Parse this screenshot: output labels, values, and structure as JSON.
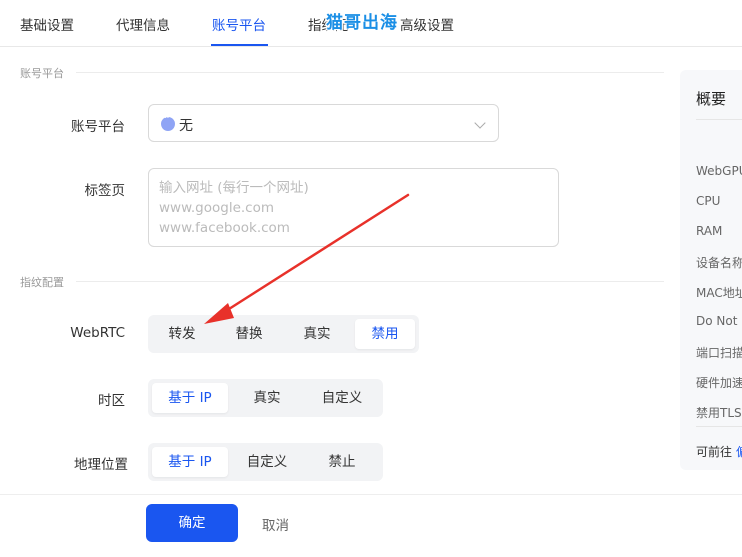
{
  "tabs": [
    {
      "label": "基础设置"
    },
    {
      "label": "代理信息"
    },
    {
      "label": "账号平台"
    },
    {
      "label": "指纹配置"
    },
    {
      "label": "高级设置"
    }
  ],
  "watermark": "猫哥出海",
  "sections": {
    "account": "账号平台",
    "fingerprint": "指纹配置"
  },
  "form": {
    "platform_label": "账号平台",
    "platform_value": "无",
    "tabs_label": "标签页",
    "tabs_placeholder": "输入网址 (每行一个网址)\nwww.google.com\nwww.facebook.com",
    "webrtc_label": "WebRTC",
    "webrtc_options": [
      "转发",
      "替换",
      "真实",
      "禁用"
    ],
    "webrtc_selected": "禁用",
    "timezone_label": "时区",
    "timezone_options": [
      "基于 IP",
      "真实",
      "自定义"
    ],
    "timezone_selected": "基于 IP",
    "geo_label": "地理位置",
    "geo_options": [
      "基于 IP",
      "自定义",
      "禁止"
    ],
    "geo_selected": "基于 IP"
  },
  "footer": {
    "confirm": "确定",
    "cancel": "取消"
  },
  "overview": {
    "title": "概要",
    "items": [
      "WebGPU",
      "CPU",
      "RAM",
      "设备名称",
      "MAC地址",
      "Do Not",
      "端口扫描",
      "硬件加速",
      "禁用TLS"
    ],
    "foot_text": "可前往",
    "foot_link": "偏"
  },
  "colors": {
    "accent": "#1a56f0",
    "annotation_arrow": "#e8312a"
  }
}
